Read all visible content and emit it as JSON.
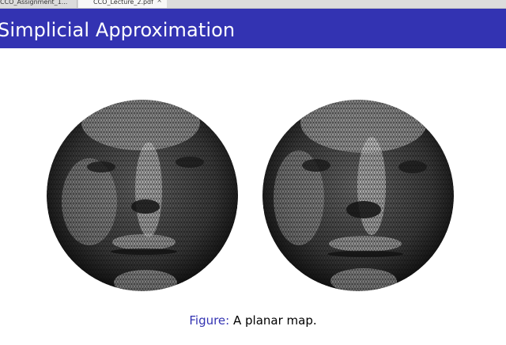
{
  "tabs": [
    {
      "label": "CCO_Assignment_1..."
    },
    {
      "label": "CCO_Lecture_2.pdf",
      "close": "×"
    }
  ],
  "slide": {
    "title": "Simplicial Approximation",
    "figure_label": "Figure:",
    "caption": "A planar map."
  },
  "colors": {
    "header_bg": "#3333b2",
    "title_text": "#ffffff",
    "caption_label": "#3333b2"
  }
}
